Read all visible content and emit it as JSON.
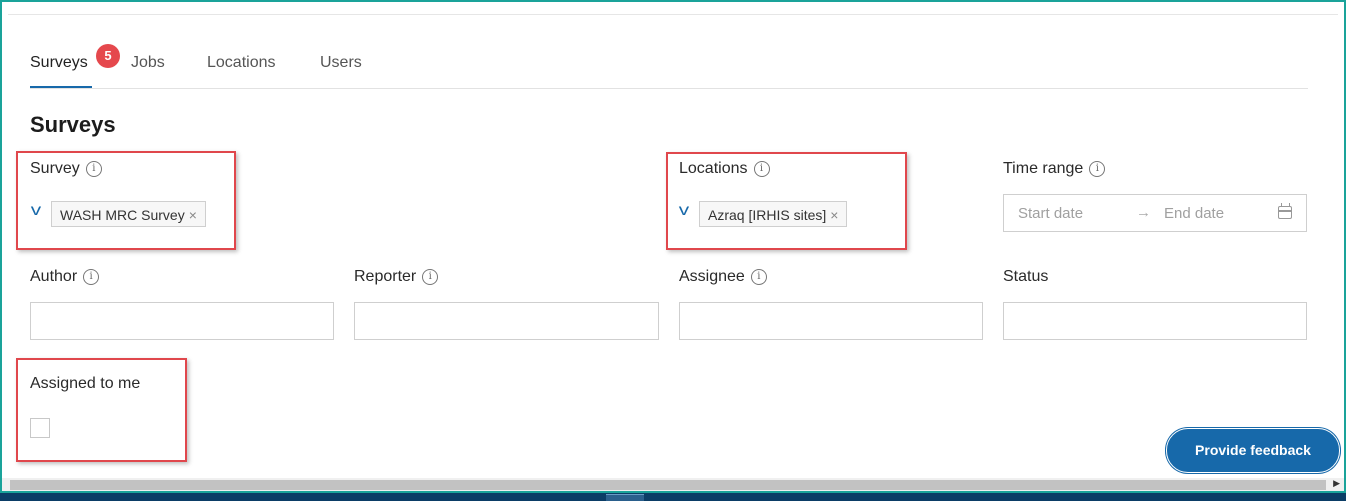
{
  "tabs": [
    {
      "label": "Surveys",
      "active": true
    },
    {
      "label": "Jobs",
      "active": false
    },
    {
      "label": "Locations",
      "active": false
    },
    {
      "label": "Users",
      "active": false
    }
  ],
  "surveys_badge": "5",
  "heading": "Surveys",
  "info_glyph": "i",
  "filters": {
    "survey": {
      "label": "Survey",
      "selected": "WASH MRC Survey"
    },
    "locations": {
      "label": "Locations",
      "selected": "Azraq [IRHIS sites]"
    },
    "time_range": {
      "label": "Time range",
      "start_placeholder": "Start date",
      "end_placeholder": "End date",
      "arrow": "→"
    },
    "author": {
      "label": "Author",
      "value": ""
    },
    "reporter": {
      "label": "Reporter",
      "value": ""
    },
    "assignee": {
      "label": "Assignee",
      "value": ""
    },
    "status": {
      "label": "Status",
      "value": ""
    },
    "assigned_to_me": {
      "label": "Assigned to me",
      "checked": false
    }
  },
  "chevron_glyph": "v",
  "remove_glyph": "×",
  "feedback_button": "Provide feedback",
  "colors": {
    "accent": "#1769aa",
    "badge": "#e5484d",
    "highlight": "#e0474c",
    "frame": "#1aa39a"
  }
}
